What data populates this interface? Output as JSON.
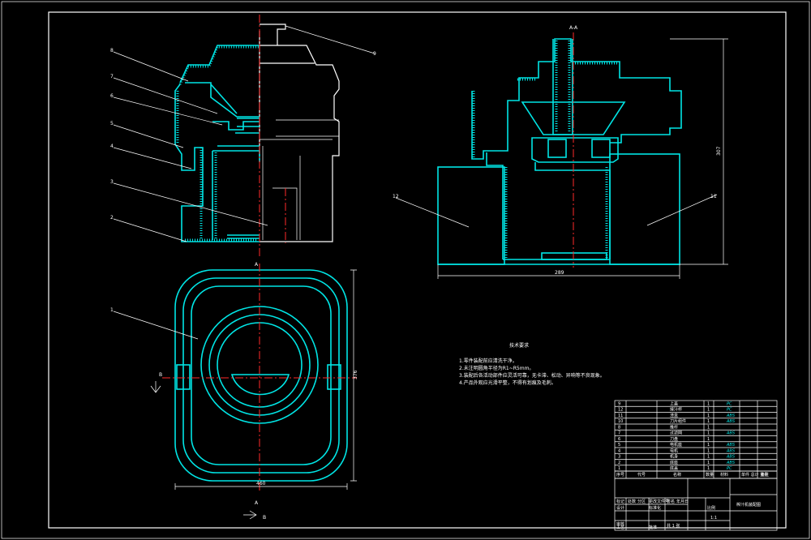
{
  "drawing": {
    "section_label": "A-A",
    "section_marks": [
      "A",
      "A",
      "B",
      "B"
    ],
    "balloons": [
      "9",
      "8",
      "7",
      "6",
      "5",
      "4",
      "3",
      "2",
      "1",
      "12",
      "11"
    ],
    "dimensions": {
      "height_right": "307",
      "width_right": "289",
      "width_plan": "460",
      "depth_plan": "376"
    },
    "tech_requirements": {
      "title": "技术要求",
      "lines": [
        "1.零件装配前应清洗干净。",
        "2.未注明圆角半径为R1~R5mm。",
        "3.装配后各活动部件应灵活可靠，无卡滞、松动、异响等不良现象。",
        "4.产品外观应光滑平整，不得有划痕及毛刺。"
      ]
    }
  },
  "title_block": {
    "parts": [
      {
        "no": "9",
        "name": "上盖",
        "qty": "1",
        "material": "PC"
      },
      {
        "no": "12",
        "name": "接汁杯",
        "qty": "1",
        "material": "PC"
      },
      {
        "no": "11",
        "name": "渣盒",
        "qty": "1",
        "material": "ABS"
      },
      {
        "no": "10",
        "name": "刀片组件",
        "qty": "1",
        "material": "ABS"
      },
      {
        "no": "8",
        "name": "推杆",
        "qty": "1",
        "material": ""
      },
      {
        "no": "7",
        "name": "过滤网",
        "qty": "1",
        "material": "ABS"
      },
      {
        "no": "6",
        "name": "刀盘",
        "qty": "1",
        "material": ""
      },
      {
        "no": "5",
        "name": "电机座",
        "qty": "1",
        "material": "ABS"
      },
      {
        "no": "4",
        "name": "电机",
        "qty": "1",
        "material": "ABS"
      },
      {
        "no": "3",
        "name": "机身",
        "qty": "1",
        "material": "ABS"
      },
      {
        "no": "2",
        "name": "底座",
        "qty": "1",
        "material": "ABS"
      },
      {
        "no": "1",
        "name": "底盖",
        "qty": "1",
        "material": "PC"
      }
    ],
    "header": {
      "no": "序号",
      "code": "代号",
      "name": "名称",
      "qty": "数量",
      "material": "材料",
      "mass": "单件 总计 重量",
      "remark": "备注"
    },
    "title": "榨汁机装配图",
    "scale_label": "比例",
    "scale": "1:1",
    "sheet": "共 1 张",
    "rows": [
      "标记",
      "处数",
      "分区",
      "更改文件号",
      "签名",
      "年月日",
      "设计",
      "标准化",
      "审核",
      "工艺",
      "批准"
    ]
  }
}
